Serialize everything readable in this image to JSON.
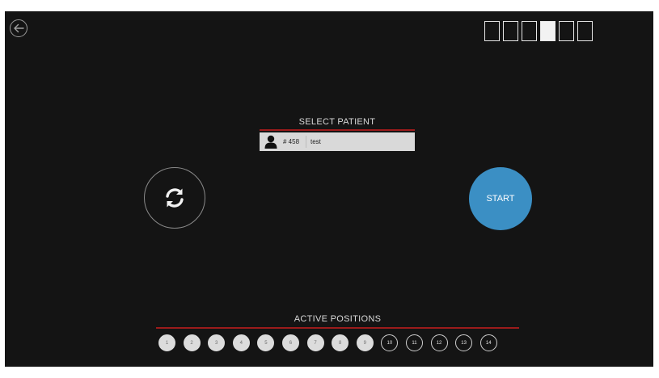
{
  "progress": {
    "total_steps": 6,
    "active_step": 4
  },
  "select_patient": {
    "title": "SELECT PATIENT",
    "patient": {
      "id": "# 458",
      "name": "test"
    }
  },
  "start_label": "START",
  "active_positions": {
    "title": "ACTIVE POSITIONS",
    "items": [
      {
        "label": "1",
        "active": true
      },
      {
        "label": "2",
        "active": true
      },
      {
        "label": "3",
        "active": true
      },
      {
        "label": "4",
        "active": true
      },
      {
        "label": "5",
        "active": true
      },
      {
        "label": "6",
        "active": true
      },
      {
        "label": "7",
        "active": true
      },
      {
        "label": "8",
        "active": true
      },
      {
        "label": "9",
        "active": true
      },
      {
        "label": "10",
        "active": false
      },
      {
        "label": "11",
        "active": false
      },
      {
        "label": "12",
        "active": false
      },
      {
        "label": "13",
        "active": false
      },
      {
        "label": "14",
        "active": false
      }
    ]
  },
  "icons": {
    "back": "arrow-left-circle-icon",
    "refresh": "refresh-icon",
    "patient": "person-icon"
  },
  "colors": {
    "background": "#141414",
    "accent": "#3b8fc4",
    "divider": "#9b1b1b"
  }
}
